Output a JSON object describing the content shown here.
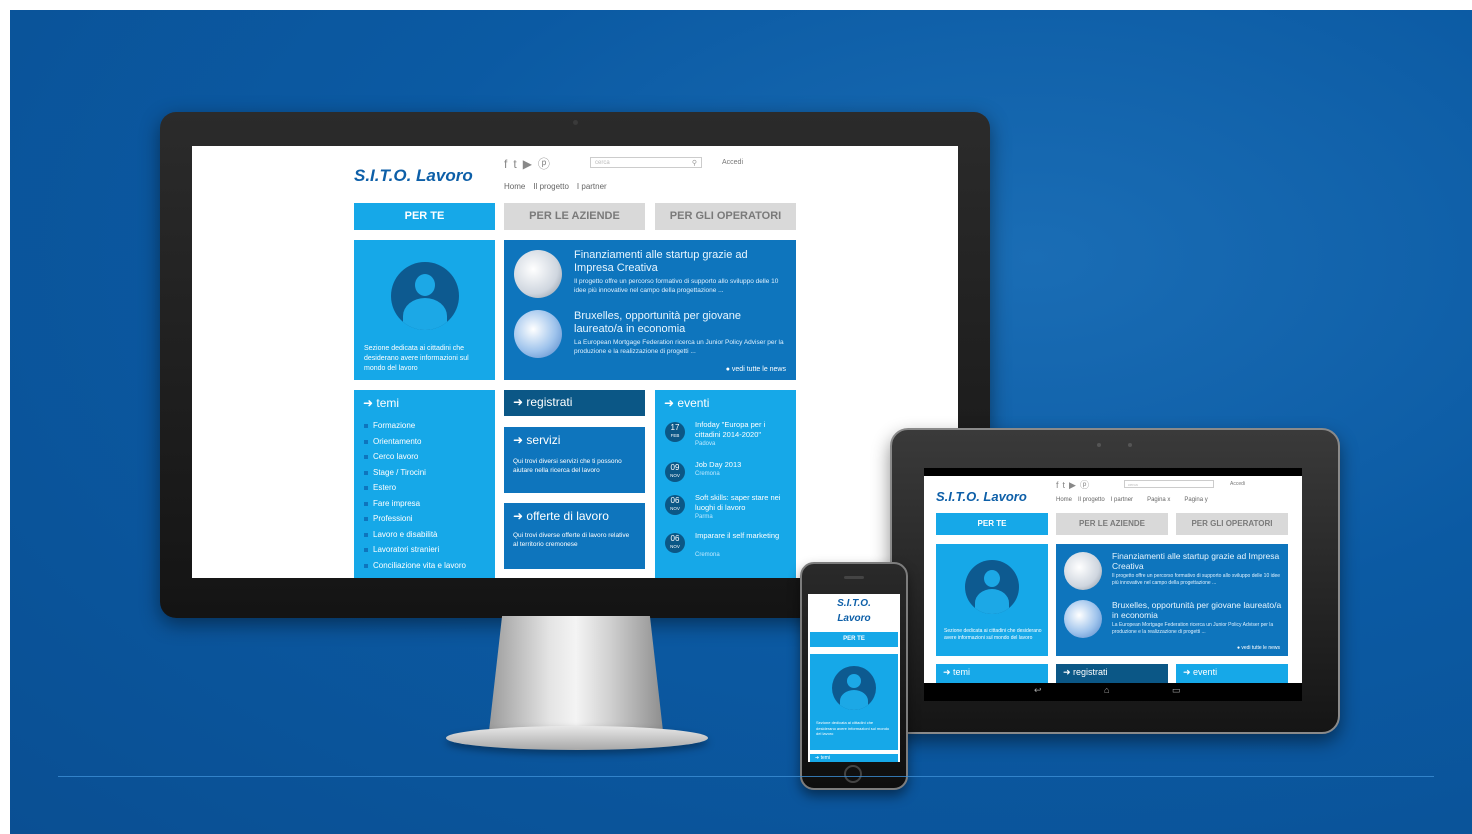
{
  "site": {
    "logo": "S.I.T.O. Lavoro",
    "logo_line1": "S.I.T.O.",
    "logo_line2": "Lavoro",
    "social_icons": [
      "facebook-icon",
      "twitter-icon",
      "youtube-icon",
      "pinterest-icon"
    ],
    "search_placeholder": "cerca",
    "login": "Accedi",
    "nav": [
      "Home",
      "Il progetto",
      "I partner"
    ],
    "nav_tablet": [
      "Home",
      "Il progetto",
      "I partner",
      "Pagina x",
      "Pagina y"
    ],
    "tabs": [
      "PER TE",
      "PER LE AZIENDE",
      "PER GLI OPERATORI"
    ],
    "perte_text": "Sezione dedicata ai cittadini che desiderano avere informazioni sul mondo del lavoro",
    "news": [
      {
        "title": "Finanziamenti alle startup grazie ad Impresa Creativa",
        "desc": "Il progetto offre un percorso formativo di supporto allo sviluppo delle 10 idee più innovative nel campo della progettazione ..."
      },
      {
        "title": "Bruxelles, opportunità per giovane laureato/a in economia",
        "desc": "La European Mortgage Federation ricerca un Junior Policy Adviser per la produzione e la realizzazione di progetti ..."
      }
    ],
    "vedi_news": "vedi tutte le news",
    "temi_title": "temi",
    "temi_items": [
      "Formazione",
      "Orientamento",
      "Cerco lavoro",
      "Stage / Tirocini",
      "Estero",
      "Fare impresa",
      "Professioni",
      "Lavoro e disabilità",
      "Lavoratori stranieri",
      "Conciliazione vita e lavoro"
    ],
    "registrati": "registrati",
    "servizi_title": "servizi",
    "servizi_desc": "Qui trovi diversi servizi che ti possono aiutare nella ricerca del lavoro",
    "offerte_title": "offerte di lavoro",
    "offerte_desc": "Qui trovi diverse offerte di lavoro relative al territorio cremonese",
    "eventi_title": "eventi",
    "eventi": [
      {
        "day": "17",
        "month": "FEB",
        "title": "Infoday \"Europa per i cittadini 2014-2020\"",
        "place": "Padova"
      },
      {
        "day": "09",
        "month": "NOV",
        "title": "Job Day 2013",
        "place": "Cremona"
      },
      {
        "day": "06",
        "month": "NOV",
        "title": "Soft skills: saper stare nei luoghi di lavoro",
        "place": "Parma"
      },
      {
        "day": "06",
        "month": "NOV",
        "title": "Imparare il self marketing",
        "place": "Cremona"
      }
    ]
  },
  "colors": {
    "background": "#0b5aa3",
    "accent_light": "#16a8e8",
    "accent_dark": "#0e75bd",
    "accent_darker": "#0b5786",
    "logo": "#0d5fa8",
    "tab_inactive": "#d9d9d9"
  }
}
